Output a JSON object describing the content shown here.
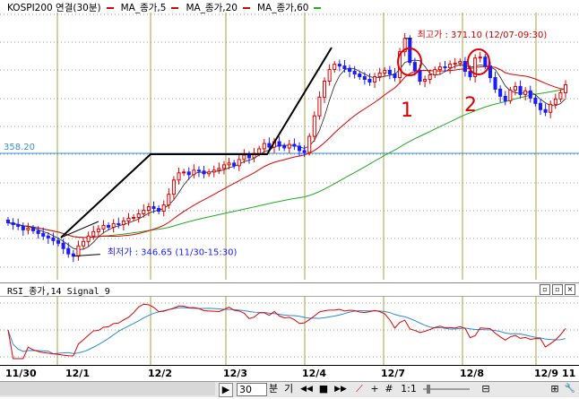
{
  "legend": {
    "title": "KOSPI200 연결(30분)",
    "items": [
      {
        "label": "MA_종가,5",
        "color": "#e00000"
      },
      {
        "label": "MA_종가,20",
        "color": "#e00000"
      },
      {
        "label": "MA_종가,60",
        "color": "#22aa22"
      }
    ]
  },
  "price_axis": {
    "ref_label": "358.20"
  },
  "annotations": {
    "high_label": "최고가 : 371.10 (12/07-09:30)",
    "low_label": "최저가 : 346.65 (11/30-15:30)",
    "mark_1": "1",
    "mark_2": "2"
  },
  "rsi_panel": {
    "header": "RSI_종가,14  Signal_9",
    "buttons": [
      "▫",
      "▫",
      "×"
    ]
  },
  "xaxis": {
    "labels": [
      "11/30",
      "12/1",
      "12/2",
      "12/3",
      "12/4",
      "12/7",
      "12/8",
      "12/9",
      "11"
    ]
  },
  "toolbar": {
    "scroll_right": "▶",
    "period_value": "30",
    "unit_min": "분",
    "unit_day": "기",
    "btn_first": "◀◀",
    "btn_stop": "■",
    "btn_play": "▶▶",
    "btn_ratio": "1:1",
    "btn_zoom_out": "⊟",
    "btn_zoom_in": "⊞",
    "btn_settings": "🔧"
  },
  "chart_data": {
    "type": "line",
    "title": "",
    "price_ylim": [
      344,
      374
    ],
    "reference_line": 358.2,
    "high": {
      "value": 371.1,
      "time": "12/07-09:30"
    },
    "low": {
      "value": 346.65,
      "time": "11/30-15:30"
    },
    "sessions": [
      "11/30",
      "12/1",
      "12/2",
      "12/3",
      "12/4",
      "12/7",
      "12/8",
      "12/9"
    ],
    "candles_close": [
      350.4,
      350.2,
      350.0,
      349.6,
      349.8,
      349.5,
      349.2,
      348.9,
      348.7,
      348.4,
      348.1,
      347.5,
      346.9,
      346.65,
      347.8,
      348.3,
      348.9,
      349.4,
      349.7,
      350.1,
      349.9,
      350.3,
      350.2,
      350.6,
      350.9,
      351.0,
      351.4,
      351.8,
      352.2,
      352.0,
      351.7,
      352.4,
      353.6,
      355.2,
      356.0,
      356.1,
      355.8,
      356.3,
      356.2,
      355.9,
      356.1,
      356.3,
      356.5,
      356.9,
      357.1,
      356.8,
      357.5,
      358.0,
      357.7,
      358.2,
      358.7,
      359.3,
      358.9,
      359.5,
      359.0,
      358.8,
      359.2,
      359.0,
      358.5,
      358.3,
      360.1,
      362.4,
      364.5,
      366.3,
      367.6,
      368.2,
      368.0,
      367.7,
      367.4,
      367.1,
      366.8,
      366.5,
      366.2,
      366.8,
      367.2,
      367.5,
      367.1,
      366.7,
      369.6,
      371.1,
      368.4,
      367.5,
      366.3,
      366.5,
      367.0,
      367.6,
      367.9,
      367.8,
      368.2,
      368.3,
      368.5,
      367.4,
      366.8,
      368.9,
      369.0,
      368.0,
      366.7,
      365.4,
      364.6,
      364.1,
      365.3,
      365.7,
      364.8,
      365.2,
      364.4,
      363.8,
      363.1,
      362.8,
      363.7,
      364.3,
      365.0,
      365.9
    ],
    "ma_series": [
      {
        "name": "MA_종가,5",
        "color": "#e00000"
      },
      {
        "name": "MA_종가,20",
        "color": "#e00000"
      },
      {
        "name": "MA_종가,60",
        "color": "#22aa22"
      }
    ],
    "rsi_series": [
      {
        "name": "RSI_종가,14",
        "color": "#e00000"
      },
      {
        "name": "Signal_9",
        "color": "#2a8ad8"
      }
    ]
  }
}
